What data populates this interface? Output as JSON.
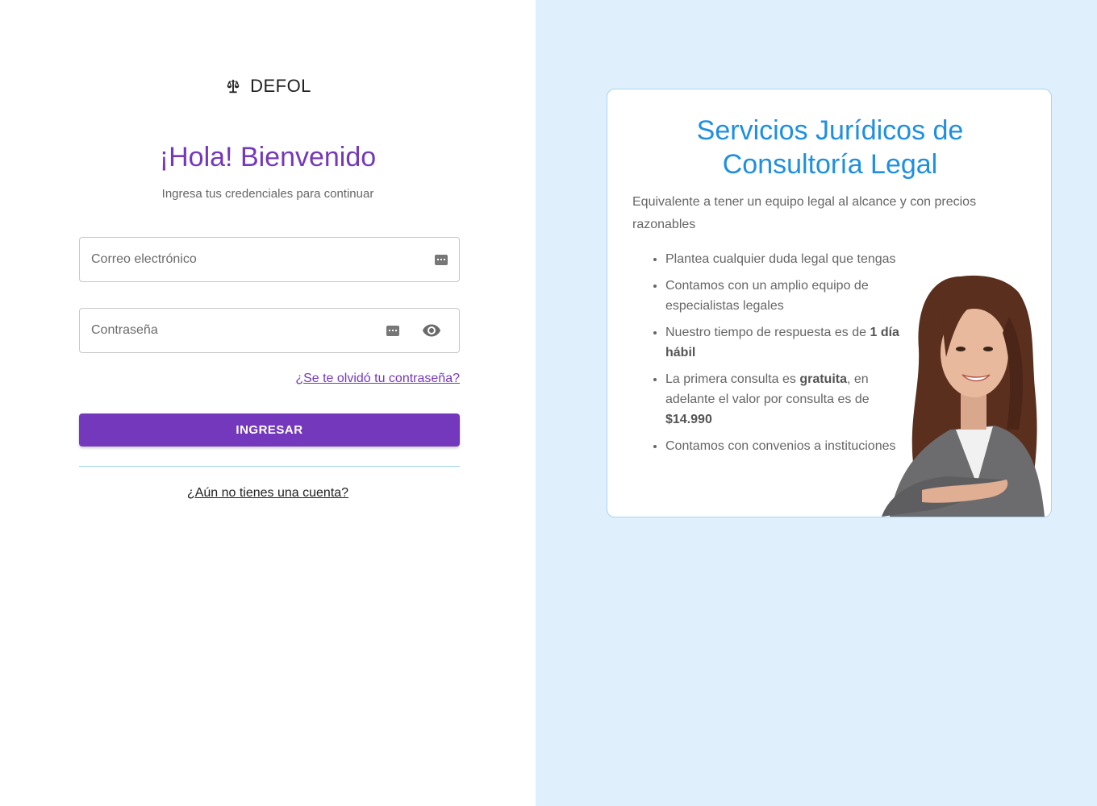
{
  "brand": {
    "name": "DEFOL",
    "icon": "scale-balance-icon"
  },
  "login": {
    "title": "¡Hola! Bienvenido",
    "subtitle": "Ingresa tus credenciales para continuar",
    "email_placeholder": "Correo electrónico",
    "password_placeholder": "Contraseña",
    "forgot_password": "¿Se te olvidó tu contraseña?",
    "submit_label": "INGRESAR",
    "signup_link": "¿Aún no tienes una cuenta?"
  },
  "info_card": {
    "title": "Servicios Jurídicos de Consultoría Legal",
    "description": "Equivalente a tener un equipo legal al alcance y con precios razonables",
    "items": [
      {
        "text": "Plantea cualquier duda legal que tengas"
      },
      {
        "text": "Contamos con un amplio equipo de especialistas legales"
      },
      {
        "before": "Nuestro tiempo de respuesta es de ",
        "bold": "1 día hábil",
        "after": ""
      },
      {
        "before": "La primera consulta es ",
        "bold": "gratuita",
        "middle": ", en adelante el valor por consulta es de ",
        "bold2": "$14.990"
      },
      {
        "text": "Contamos con convenios a instituciones"
      }
    ]
  },
  "colors": {
    "accent": "#7438bd",
    "info_title": "#1e8fe1",
    "right_background": "#dff0fc"
  }
}
